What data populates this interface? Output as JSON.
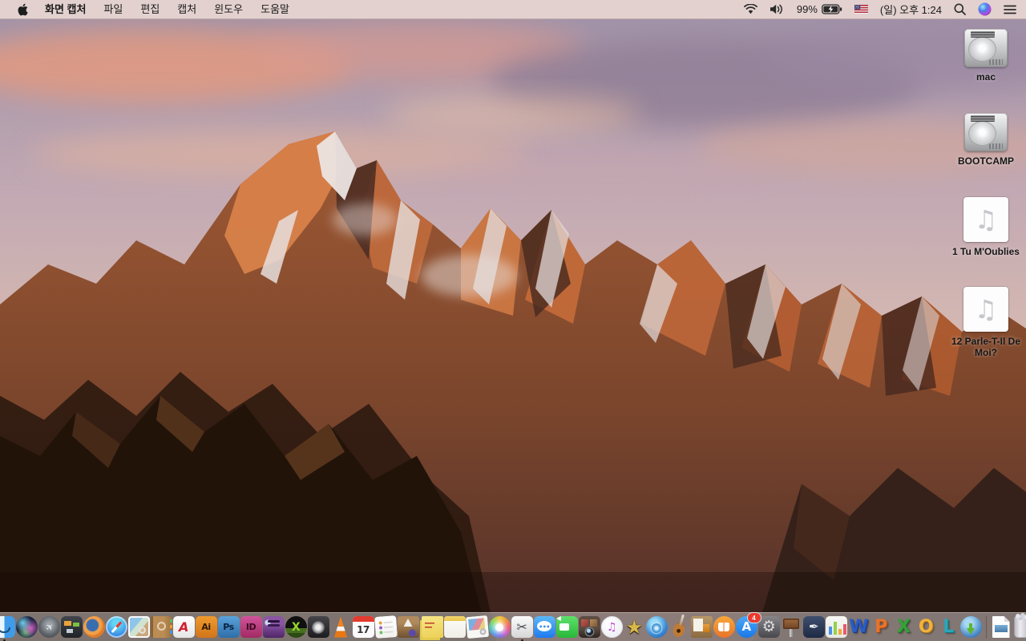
{
  "menu_bar": {
    "app_menus": [
      {
        "name": "app-title",
        "label": "화면 캡처",
        "bold": true
      },
      {
        "name": "file",
        "label": "파일"
      },
      {
        "name": "edit",
        "label": "편집"
      },
      {
        "name": "capture",
        "label": "캡처"
      },
      {
        "name": "window",
        "label": "윈도우"
      },
      {
        "name": "help",
        "label": "도움말"
      }
    ],
    "status": {
      "battery_percent": "99%",
      "clock": "(일) 오후 1:24"
    }
  },
  "desktop_icons": [
    {
      "name": "mac",
      "type": "harddrive",
      "label": "mac"
    },
    {
      "name": "bootcamp",
      "type": "harddrive",
      "label": "BOOTCAMP"
    },
    {
      "name": "audio-1",
      "type": "audio",
      "label": "1 Tu M'Oublies"
    },
    {
      "name": "audio-12",
      "type": "audio",
      "label": "12 Parle-T-Il De Moi?"
    }
  ],
  "dock_items": [
    {
      "name": "finder",
      "running": true
    },
    {
      "name": "siri"
    },
    {
      "name": "launchpad",
      "glyph": "✈"
    },
    {
      "name": "mission-control"
    },
    {
      "name": "firefox"
    },
    {
      "name": "safari"
    },
    {
      "name": "preview"
    },
    {
      "name": "contacts"
    },
    {
      "name": "acrobat-reader",
      "glyph": "A"
    },
    {
      "name": "illustrator",
      "glyph": "Ai"
    },
    {
      "name": "photoshop",
      "glyph": "Ps"
    },
    {
      "name": "indesign",
      "glyph": "ID"
    },
    {
      "name": "toast"
    },
    {
      "name": "xee",
      "glyph": "X"
    },
    {
      "name": "fan-control"
    },
    {
      "name": "vlc"
    },
    {
      "name": "calendar",
      "glyph": "17"
    },
    {
      "name": "reminders"
    },
    {
      "name": "stuffit"
    },
    {
      "name": "stickies"
    },
    {
      "name": "notes"
    },
    {
      "name": "image-viewer"
    },
    {
      "name": "photos"
    },
    {
      "name": "screen-capture",
      "glyph": "✂",
      "running": true
    },
    {
      "name": "messages",
      "glyph": "•••"
    },
    {
      "name": "facetime"
    },
    {
      "name": "photo-booth"
    },
    {
      "name": "itunes",
      "glyph": "♫"
    },
    {
      "name": "screenflow",
      "glyph": "★"
    },
    {
      "name": "video-converter"
    },
    {
      "name": "garageband"
    },
    {
      "name": "scrapbook"
    },
    {
      "name": "ibooks"
    },
    {
      "name": "app-store",
      "glyph": "A",
      "badge": "4"
    },
    {
      "name": "system-preferences",
      "glyph": "⚙"
    },
    {
      "name": "keynote"
    },
    {
      "name": "pages",
      "glyph": "✒"
    },
    {
      "name": "numbers"
    },
    {
      "name": "word",
      "glyph": "W"
    },
    {
      "name": "powerpoint",
      "glyph": "P"
    },
    {
      "name": "excel",
      "glyph": "X"
    },
    {
      "name": "outlook",
      "glyph": "O"
    },
    {
      "name": "lync",
      "glyph": "L"
    },
    {
      "name": "downloader"
    },
    {
      "name": "divider",
      "divider": true
    },
    {
      "name": "jpeg-document"
    },
    {
      "name": "trash"
    }
  ],
  "colors": {
    "menubar_bg": "rgba(231,214,211,0.95)",
    "dock_bg": "rgba(205,198,196,0.55)",
    "badge": "#ec3b2f",
    "desktop_label": "#161616"
  }
}
